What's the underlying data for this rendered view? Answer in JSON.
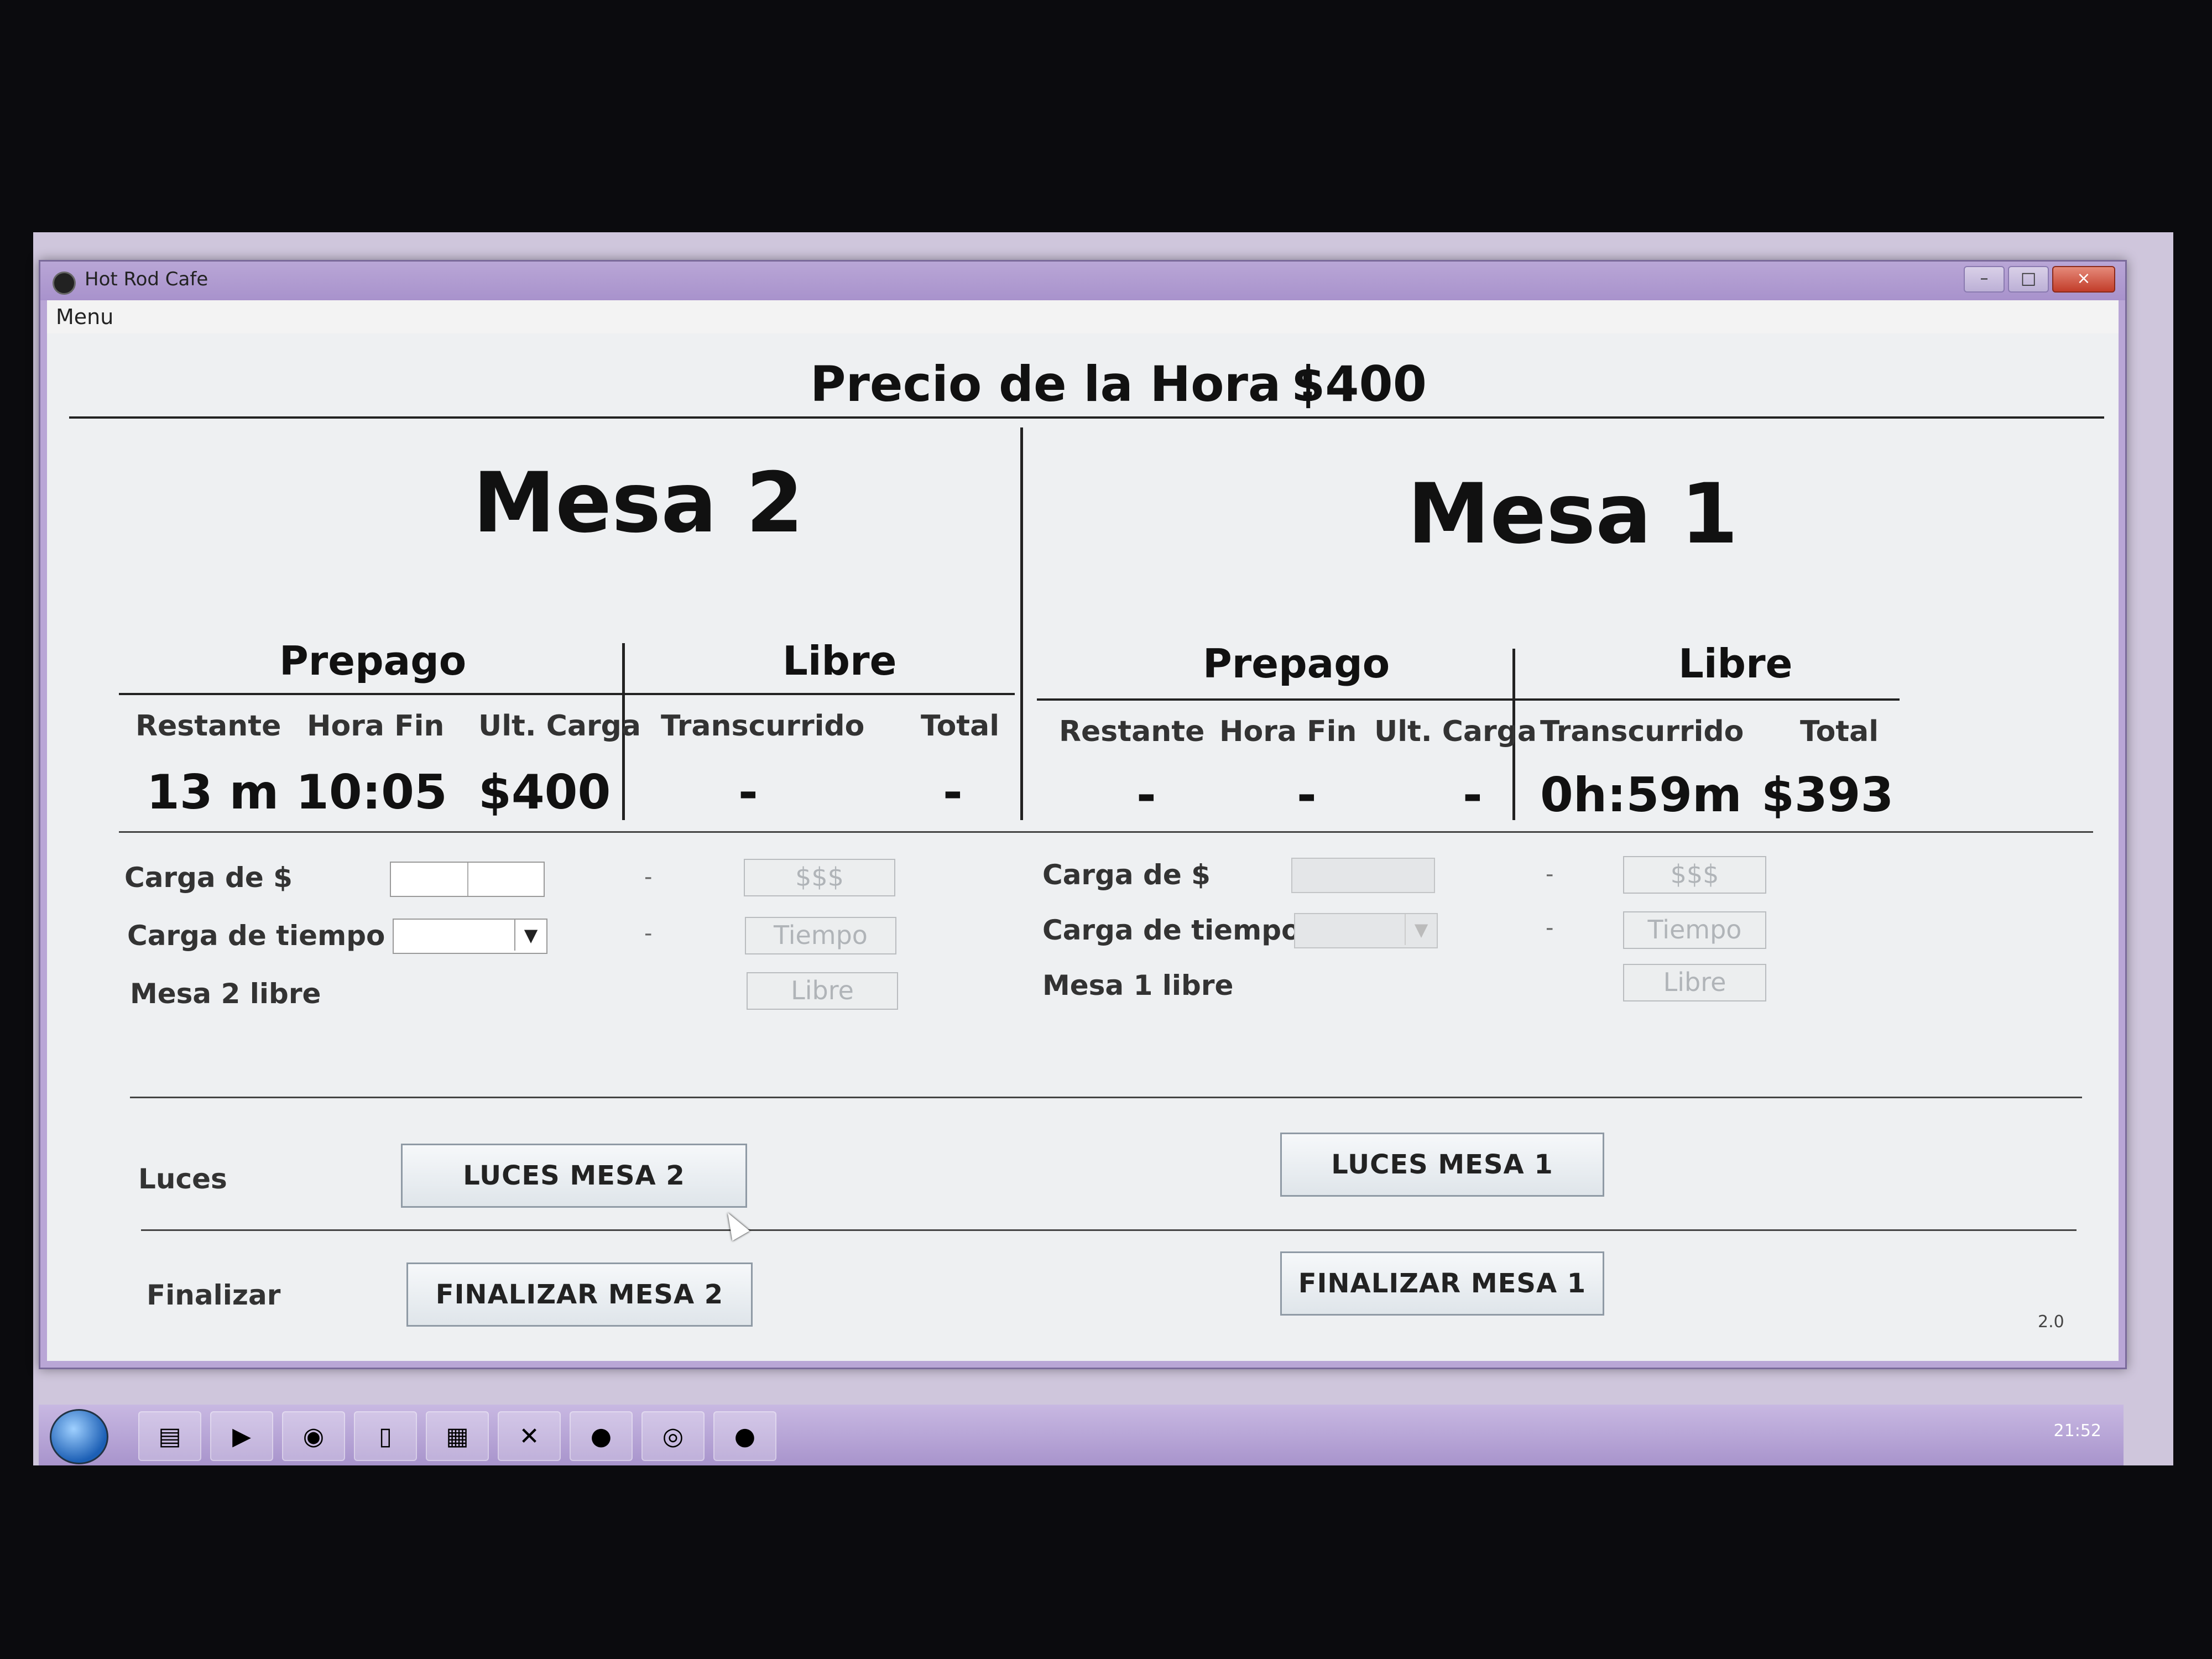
{
  "window": {
    "title": "Hot Rod Cafe",
    "controls": {
      "minimize": "–",
      "maximize": "□",
      "close": "×"
    }
  },
  "menubar": {
    "menu": "Menu"
  },
  "header": {
    "price_label": "Precio de la Hora :",
    "price_value": "$400"
  },
  "mesa2": {
    "title": "Mesa 2",
    "prepago": {
      "heading": "Prepago",
      "columns": [
        "Restante",
        "Hora Fin",
        "Ult. Carga"
      ],
      "values": [
        "13 m",
        "10:05",
        "$400"
      ]
    },
    "libre": {
      "heading": "Libre",
      "columns": [
        "Transcurrido",
        "Total"
      ],
      "values": [
        "-",
        "-"
      ]
    },
    "form": {
      "carga_dinero_label": "Carga de $",
      "carga_tiempo_label": "Carga de tiempo",
      "libre_label": "Mesa 2 libre",
      "dash": "-",
      "btn_dinero": "$$$",
      "btn_tiempo": "Tiempo",
      "btn_libre": "Libre"
    },
    "luces_button": "LUCES MESA 2",
    "finalizar_button": "FINALIZAR MESA 2"
  },
  "mesa1": {
    "title": "Mesa 1",
    "prepago": {
      "heading": "Prepago",
      "columns": [
        "Restante",
        "Hora Fin",
        "Ult. Carga"
      ],
      "values": [
        "-",
        "-",
        "-"
      ]
    },
    "libre": {
      "heading": "Libre",
      "columns": [
        "Transcurrido",
        "Total"
      ],
      "values": [
        "0h:59m",
        "$393"
      ]
    },
    "form": {
      "carga_dinero_label": "Carga de $",
      "carga_tiempo_label": "Carga de tiempo",
      "libre_label": "Mesa 1 libre",
      "dash": "-",
      "btn_dinero": "$$$",
      "btn_tiempo": "Tiempo",
      "btn_libre": "Libre"
    },
    "luces_button": "LUCES MESA 1",
    "finalizar_button": "FINALIZAR MESA 1"
  },
  "rows": {
    "luces_label": "Luces",
    "finalizar_label": "Finalizar"
  },
  "version": "2.0",
  "taskbar": {
    "start_icon": "windows-start-icon",
    "items": [
      "folder-icon",
      "media-player-icon",
      "chrome-icon",
      "notepad-icon",
      "powerpoint-icon",
      "excel-icon",
      "pinterest-icon",
      "spotify-icon",
      "app-8ball-icon"
    ],
    "clock": "21:52"
  }
}
